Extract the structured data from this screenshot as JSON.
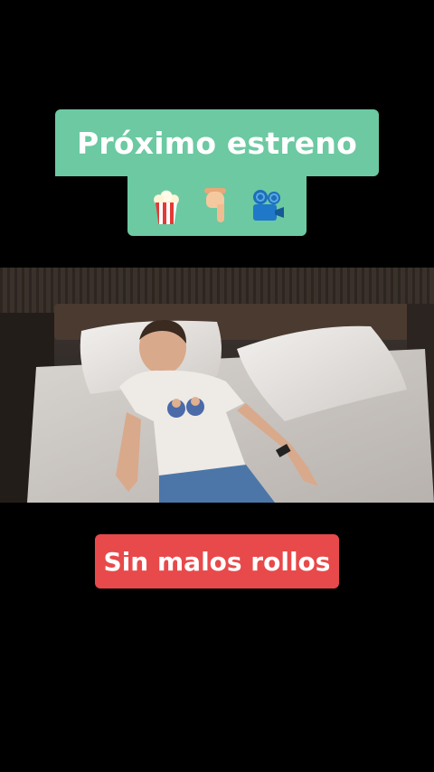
{
  "caption_top": {
    "line1": "Próximo estreno",
    "emojis": [
      "popcorn-icon",
      "pointing-down-hand-icon",
      "movie-camera-icon"
    ],
    "background": "#6cc9a2"
  },
  "video": {
    "scene": "man-lying-on-bed"
  },
  "caption_bottom": {
    "text": "Sin malos rollos",
    "background": "#e8494a"
  }
}
